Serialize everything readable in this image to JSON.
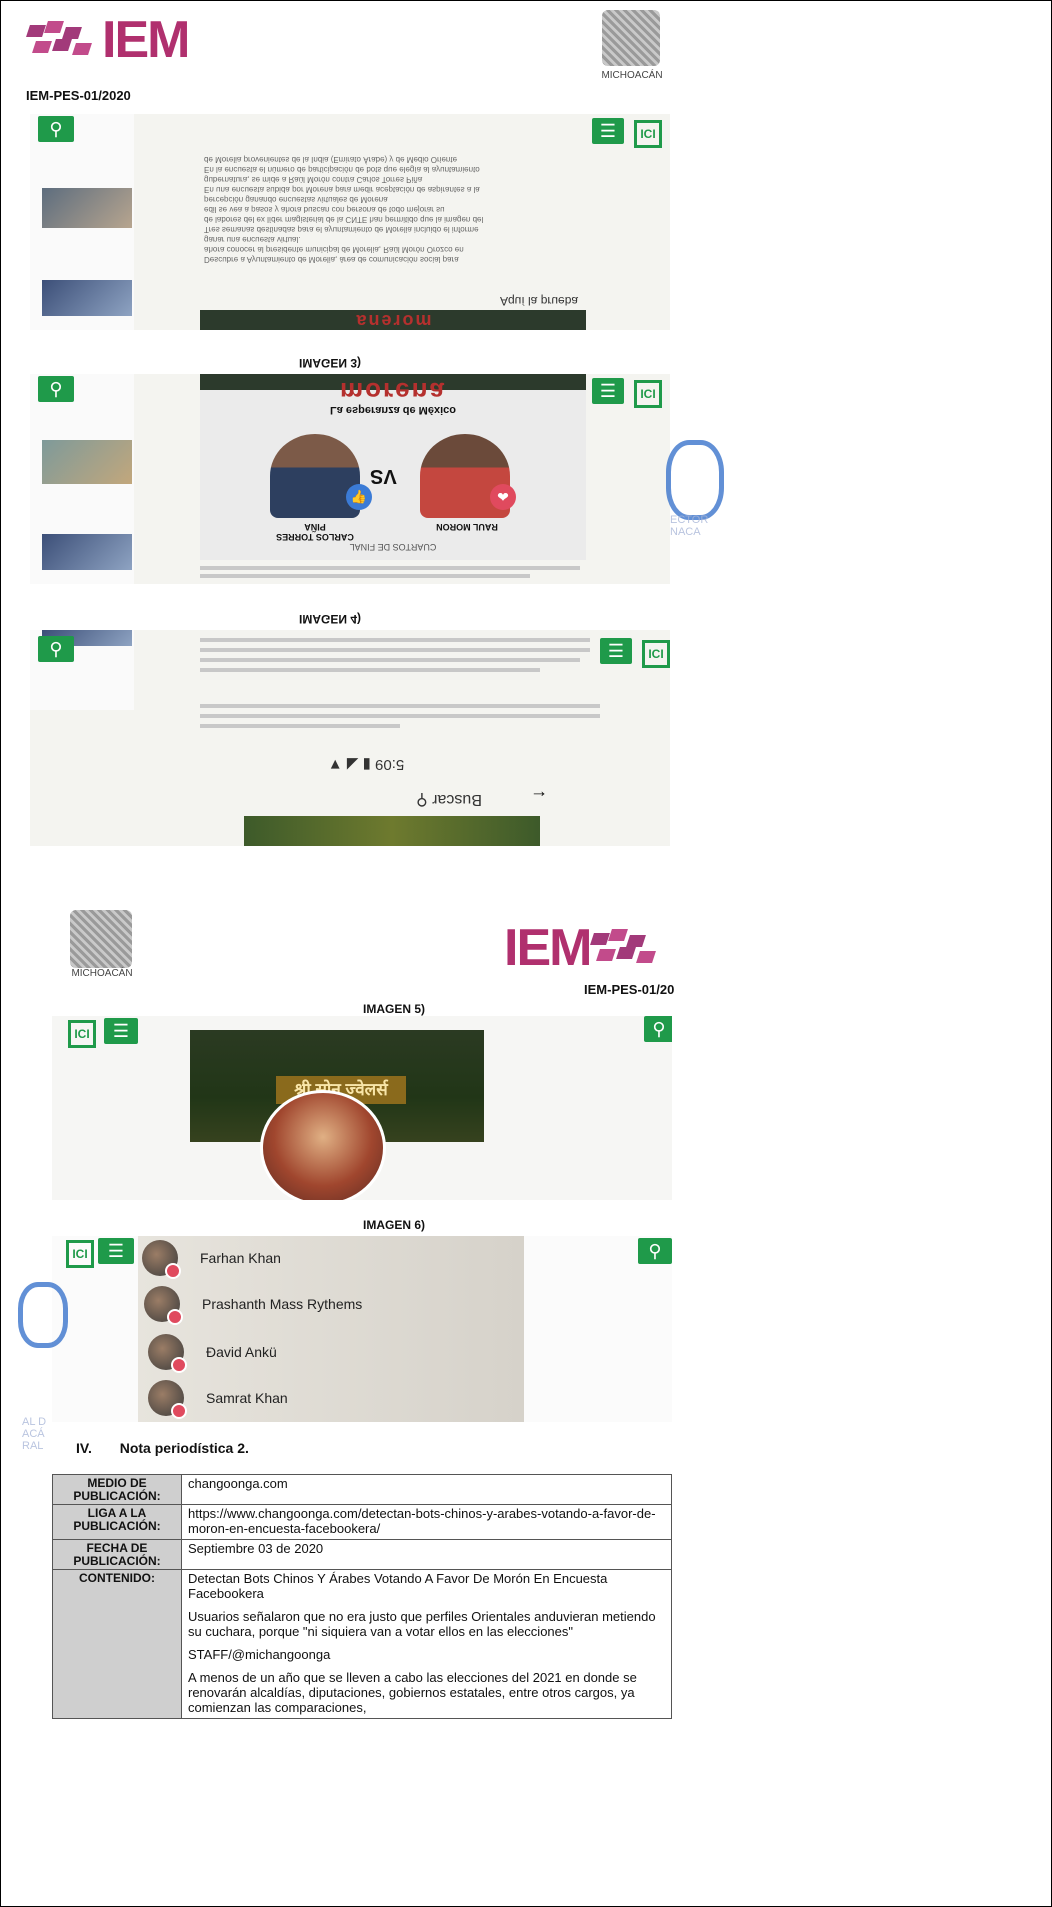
{
  "header_top": {
    "logo_text": "IEM",
    "doc_id": "IEM-PES-01/2020",
    "seal_caption": "MICHOACÁN"
  },
  "screenshot1": {
    "lines": [
      "Descubre a Ayuntamiento de Morelia, área de comunicación social para",
      "ahora conocer al presidente municipal de Morelia, Raúl Morón Orozco en",
      "ganar una encuesta virtual.",
      "Tres semanas destinadas para el ayuntamiento de Morelia incluido el informe",
      "de labores del ex líder magisterial de la CNTE han permitido que la imagen del",
      "edil se vea a pasos y ahora buscan con persona de todo mejorar su",
      "percepción ganando encuestas virtuales de Morena",
      "En una encuesta subida por Morena para medir aceptación de aspirantes a la",
      "gubernatura, se mide a Raúl Morón contra Carlos Torres Piña",
      "En la encuesta el número de participación de bots que elegía al ayuntamiento",
      "de Morelia provenientes de la India (Emirato Árabe) y de Medio Oriente"
    ],
    "aqui_la_prueba": "Aquí la prueba",
    "banner_word": "morena"
  },
  "labels": {
    "imagen3": "IMAGEN 3)",
    "imagen4": "IMAGEN 4)",
    "imagen5": "IMAGEN 5)",
    "imagen6": "IMAGEN 6)"
  },
  "screenshot2": {
    "banner_word": "morena",
    "subtitle": "La esperanza de México",
    "vs": "VS",
    "left_name": "RAUL MORON",
    "right_name": "CARLOS TORRES PIÑA",
    "footer": "CUARTOS DE FINAL"
  },
  "screenshot3": {
    "status": "5:09",
    "search_placeholder": "Buscar"
  },
  "header_bottom": {
    "logo_text": "IEM",
    "doc_id": "IEM-PES-01/20",
    "seal_caption": "MICHOACÁN"
  },
  "screenshot5": {
    "shop_title": "श्री सोनू ज्वेलर्स"
  },
  "screenshot6": {
    "people": [
      "Farhan Khan",
      "Prashanth Mass Rythems",
      "Đavid Ankü",
      "Samrat Khan"
    ]
  },
  "section": {
    "number": "IV.",
    "title": "Nota periodística 2."
  },
  "table": {
    "rows": [
      {
        "key": "MEDIO DE PUBLICACIÓN:",
        "value": "changoonga.com"
      },
      {
        "key": "LIGA A LA PUBLICACIÓN:",
        "value": "https://www.changoonga.com/detectan-bots-chinos-y-arabes-votando-a-favor-de-moron-en-encuesta-facebookera/"
      },
      {
        "key": "FECHA DE PUBLICACIÓN:",
        "value": "Septiembre 03 de 2020"
      }
    ],
    "content_key": "CONTENIDO:",
    "content": [
      "Detectan Bots Chinos Y Árabes Votando A Favor De Morón En Encuesta Facebookera",
      "Usuarios señalaron que no era justo que perfiles Orientales anduvieran metiendo su cuchara, porque \"ni siquiera van a votar ellos en las elecciones\"",
      "STAFF/@michangoonga",
      "A menos de un año que se lleven a cabo las elecciones del 2021 en donde se renovarán alcaldías, diputaciones, gobiernos estatales, entre otros cargos, ya comienzan las comparaciones,"
    ]
  }
}
